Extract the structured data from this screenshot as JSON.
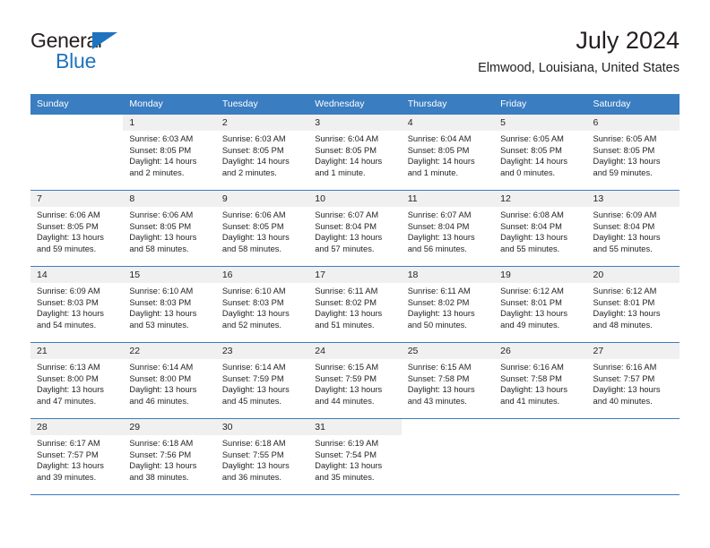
{
  "brand": {
    "word_general": "General",
    "word_blue": "Blue",
    "accent_color": "#1e73be",
    "header_color": "#3a7dc1"
  },
  "title": "July 2024",
  "location": "Elmwood, Louisiana, United States",
  "weekday_headers": [
    "Sunday",
    "Monday",
    "Tuesday",
    "Wednesday",
    "Thursday",
    "Friday",
    "Saturday"
  ],
  "weeks": [
    [
      {
        "day": "",
        "sunrise": "",
        "sunset": "",
        "daylight1": "",
        "daylight2": ""
      },
      {
        "day": "1",
        "sunrise": "Sunrise: 6:03 AM",
        "sunset": "Sunset: 8:05 PM",
        "daylight1": "Daylight: 14 hours",
        "daylight2": "and 2 minutes."
      },
      {
        "day": "2",
        "sunrise": "Sunrise: 6:03 AM",
        "sunset": "Sunset: 8:05 PM",
        "daylight1": "Daylight: 14 hours",
        "daylight2": "and 2 minutes."
      },
      {
        "day": "3",
        "sunrise": "Sunrise: 6:04 AM",
        "sunset": "Sunset: 8:05 PM",
        "daylight1": "Daylight: 14 hours",
        "daylight2": "and 1 minute."
      },
      {
        "day": "4",
        "sunrise": "Sunrise: 6:04 AM",
        "sunset": "Sunset: 8:05 PM",
        "daylight1": "Daylight: 14 hours",
        "daylight2": "and 1 minute."
      },
      {
        "day": "5",
        "sunrise": "Sunrise: 6:05 AM",
        "sunset": "Sunset: 8:05 PM",
        "daylight1": "Daylight: 14 hours",
        "daylight2": "and 0 minutes."
      },
      {
        "day": "6",
        "sunrise": "Sunrise: 6:05 AM",
        "sunset": "Sunset: 8:05 PM",
        "daylight1": "Daylight: 13 hours",
        "daylight2": "and 59 minutes."
      }
    ],
    [
      {
        "day": "7",
        "sunrise": "Sunrise: 6:06 AM",
        "sunset": "Sunset: 8:05 PM",
        "daylight1": "Daylight: 13 hours",
        "daylight2": "and 59 minutes."
      },
      {
        "day": "8",
        "sunrise": "Sunrise: 6:06 AM",
        "sunset": "Sunset: 8:05 PM",
        "daylight1": "Daylight: 13 hours",
        "daylight2": "and 58 minutes."
      },
      {
        "day": "9",
        "sunrise": "Sunrise: 6:06 AM",
        "sunset": "Sunset: 8:05 PM",
        "daylight1": "Daylight: 13 hours",
        "daylight2": "and 58 minutes."
      },
      {
        "day": "10",
        "sunrise": "Sunrise: 6:07 AM",
        "sunset": "Sunset: 8:04 PM",
        "daylight1": "Daylight: 13 hours",
        "daylight2": "and 57 minutes."
      },
      {
        "day": "11",
        "sunrise": "Sunrise: 6:07 AM",
        "sunset": "Sunset: 8:04 PM",
        "daylight1": "Daylight: 13 hours",
        "daylight2": "and 56 minutes."
      },
      {
        "day": "12",
        "sunrise": "Sunrise: 6:08 AM",
        "sunset": "Sunset: 8:04 PM",
        "daylight1": "Daylight: 13 hours",
        "daylight2": "and 55 minutes."
      },
      {
        "day": "13",
        "sunrise": "Sunrise: 6:09 AM",
        "sunset": "Sunset: 8:04 PM",
        "daylight1": "Daylight: 13 hours",
        "daylight2": "and 55 minutes."
      }
    ],
    [
      {
        "day": "14",
        "sunrise": "Sunrise: 6:09 AM",
        "sunset": "Sunset: 8:03 PM",
        "daylight1": "Daylight: 13 hours",
        "daylight2": "and 54 minutes."
      },
      {
        "day": "15",
        "sunrise": "Sunrise: 6:10 AM",
        "sunset": "Sunset: 8:03 PM",
        "daylight1": "Daylight: 13 hours",
        "daylight2": "and 53 minutes."
      },
      {
        "day": "16",
        "sunrise": "Sunrise: 6:10 AM",
        "sunset": "Sunset: 8:03 PM",
        "daylight1": "Daylight: 13 hours",
        "daylight2": "and 52 minutes."
      },
      {
        "day": "17",
        "sunrise": "Sunrise: 6:11 AM",
        "sunset": "Sunset: 8:02 PM",
        "daylight1": "Daylight: 13 hours",
        "daylight2": "and 51 minutes."
      },
      {
        "day": "18",
        "sunrise": "Sunrise: 6:11 AM",
        "sunset": "Sunset: 8:02 PM",
        "daylight1": "Daylight: 13 hours",
        "daylight2": "and 50 minutes."
      },
      {
        "day": "19",
        "sunrise": "Sunrise: 6:12 AM",
        "sunset": "Sunset: 8:01 PM",
        "daylight1": "Daylight: 13 hours",
        "daylight2": "and 49 minutes."
      },
      {
        "day": "20",
        "sunrise": "Sunrise: 6:12 AM",
        "sunset": "Sunset: 8:01 PM",
        "daylight1": "Daylight: 13 hours",
        "daylight2": "and 48 minutes."
      }
    ],
    [
      {
        "day": "21",
        "sunrise": "Sunrise: 6:13 AM",
        "sunset": "Sunset: 8:00 PM",
        "daylight1": "Daylight: 13 hours",
        "daylight2": "and 47 minutes."
      },
      {
        "day": "22",
        "sunrise": "Sunrise: 6:14 AM",
        "sunset": "Sunset: 8:00 PM",
        "daylight1": "Daylight: 13 hours",
        "daylight2": "and 46 minutes."
      },
      {
        "day": "23",
        "sunrise": "Sunrise: 6:14 AM",
        "sunset": "Sunset: 7:59 PM",
        "daylight1": "Daylight: 13 hours",
        "daylight2": "and 45 minutes."
      },
      {
        "day": "24",
        "sunrise": "Sunrise: 6:15 AM",
        "sunset": "Sunset: 7:59 PM",
        "daylight1": "Daylight: 13 hours",
        "daylight2": "and 44 minutes."
      },
      {
        "day": "25",
        "sunrise": "Sunrise: 6:15 AM",
        "sunset": "Sunset: 7:58 PM",
        "daylight1": "Daylight: 13 hours",
        "daylight2": "and 43 minutes."
      },
      {
        "day": "26",
        "sunrise": "Sunrise: 6:16 AM",
        "sunset": "Sunset: 7:58 PM",
        "daylight1": "Daylight: 13 hours",
        "daylight2": "and 41 minutes."
      },
      {
        "day": "27",
        "sunrise": "Sunrise: 6:16 AM",
        "sunset": "Sunset: 7:57 PM",
        "daylight1": "Daylight: 13 hours",
        "daylight2": "and 40 minutes."
      }
    ],
    [
      {
        "day": "28",
        "sunrise": "Sunrise: 6:17 AM",
        "sunset": "Sunset: 7:57 PM",
        "daylight1": "Daylight: 13 hours",
        "daylight2": "and 39 minutes."
      },
      {
        "day": "29",
        "sunrise": "Sunrise: 6:18 AM",
        "sunset": "Sunset: 7:56 PM",
        "daylight1": "Daylight: 13 hours",
        "daylight2": "and 38 minutes."
      },
      {
        "day": "30",
        "sunrise": "Sunrise: 6:18 AM",
        "sunset": "Sunset: 7:55 PM",
        "daylight1": "Daylight: 13 hours",
        "daylight2": "and 36 minutes."
      },
      {
        "day": "31",
        "sunrise": "Sunrise: 6:19 AM",
        "sunset": "Sunset: 7:54 PM",
        "daylight1": "Daylight: 13 hours",
        "daylight2": "and 35 minutes."
      },
      {
        "day": "",
        "sunrise": "",
        "sunset": "",
        "daylight1": "",
        "daylight2": ""
      },
      {
        "day": "",
        "sunrise": "",
        "sunset": "",
        "daylight1": "",
        "daylight2": ""
      },
      {
        "day": "",
        "sunrise": "",
        "sunset": "",
        "daylight1": "",
        "daylight2": ""
      }
    ]
  ]
}
